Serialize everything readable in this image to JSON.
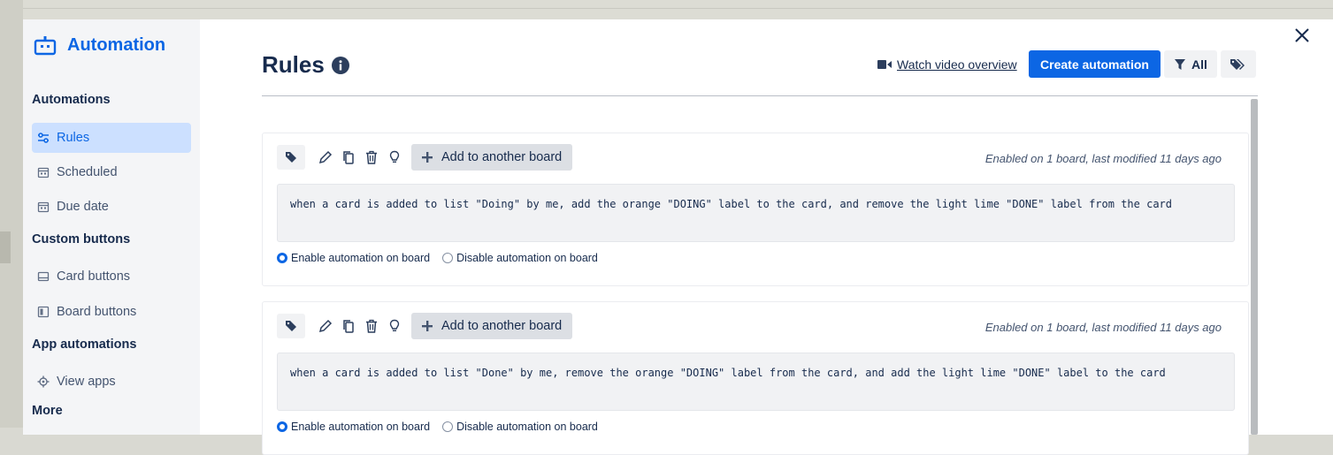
{
  "sidebar": {
    "title": "Automation",
    "sections": [
      {
        "title": "Automations",
        "items": [
          {
            "label": "Rules",
            "icon": "sliders-icon",
            "active": true
          },
          {
            "label": "Scheduled",
            "icon": "calendar-icon"
          },
          {
            "label": "Due date",
            "icon": "calendar-icon"
          }
        ]
      },
      {
        "title": "Custom buttons",
        "items": [
          {
            "label": "Card buttons",
            "icon": "card-icon"
          },
          {
            "label": "Board buttons",
            "icon": "board-icon"
          }
        ]
      },
      {
        "title": "App automations",
        "items": [
          {
            "label": "View apps",
            "icon": "gear-icon"
          }
        ]
      },
      {
        "title": "More",
        "items": []
      }
    ]
  },
  "header": {
    "title": "Rules",
    "watch_label": "Watch video overview",
    "create_label": "Create automation",
    "filter_label": "All"
  },
  "rules": [
    {
      "add_board_label": "Add to another board",
      "meta": "Enabled on 1 board, last modified 11 days ago",
      "text": "when a card is added to list \"Doing\" by me, add the orange \"DOING\" label to the card, and remove the light lime \"DONE\" label from the card",
      "enable_label": "Enable automation on board",
      "disable_label": "Disable automation on board",
      "enabled": true
    },
    {
      "add_board_label": "Add to another board",
      "meta": "Enabled on 1 board, last modified 11 days ago",
      "text": "when a card is added to list \"Done\" by me, remove the orange \"DOING\" label from the card, and add the light lime \"DONE\" label to the card",
      "enable_label": "Enable automation on board",
      "disable_label": "Disable automation on board",
      "enabled": true
    }
  ],
  "colors": {
    "accent": "#0c66e4",
    "active_bg": "#cce0ff",
    "sidebar_bg": "#f4f5f7"
  }
}
